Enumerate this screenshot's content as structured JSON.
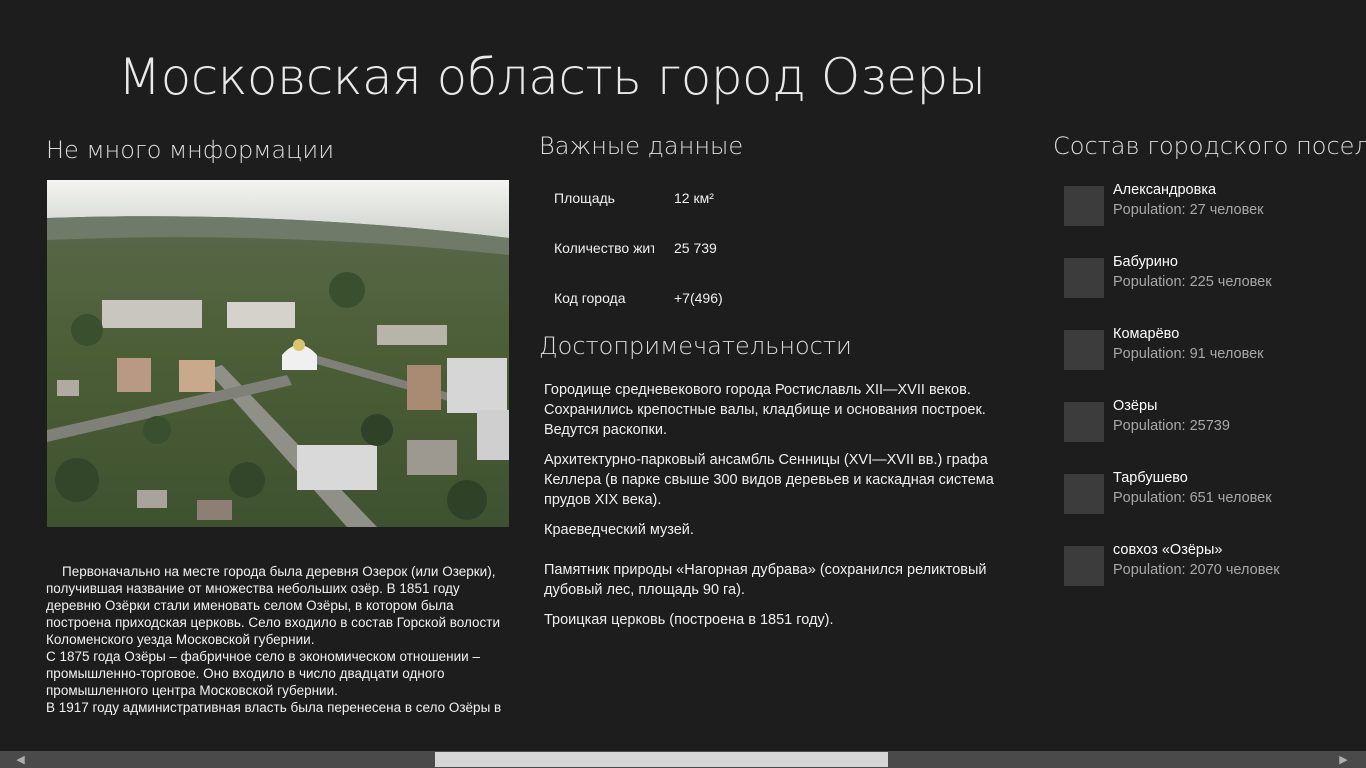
{
  "page": {
    "title": "Московская область город Озеры"
  },
  "info": {
    "heading": "Не много мнформации",
    "photo_alt": "city-aerial-photo",
    "history": [
      "Первоначально на месте города была деревня Озерок (или Озерки), получившая название от множества небольших озёр. В 1851 году деревню Озёрки стали именовать селом Озёры, в котором была построена приходская церковь. Село входило в состав Горской волости Коломенского уезда Московской губернии.",
      "С 1875 года Озёры – фабричное село в экономическом отношении – промышленно-торговое. Оно входило в число двадцати одного промышленного центра Московской губернии.",
      "В 1917 году административная власть была перенесена в село Озёры в"
    ]
  },
  "facts": {
    "heading": "Важные данные",
    "rows": [
      {
        "label": "Площадь",
        "value": "12 км²"
      },
      {
        "label": "Количество жит",
        "value": "25 739"
      },
      {
        "label": "Код города",
        "value": "+7(496)"
      }
    ]
  },
  "sights": {
    "heading": "Достопримечательности",
    "items": [
      "Городище средневекового города Ростиславль XII—XVII веков. Сохранились крепостные валы, кладбище и основания построек. Ведутся раскопки.",
      "Архитектурно-парковый ансамбль Сенницы (XVI—XVII вв.) графа Келлера (в парке свыше 300 видов деревьев и каскадная система прудов XIX века).",
      "Краеведческий музей.",
      "Памятник природы «Нагорная дубрава» (сохранился реликтовый дубовый лес, площадь 90 га).",
      "Троицкая церковь (построена в 1851 году)."
    ]
  },
  "settlements": {
    "heading": "Состав городского поселения",
    "items": [
      {
        "name": "Александровка",
        "population": "Population: 27 человек"
      },
      {
        "name": "Бабурино",
        "population": "Population: 225 человек"
      },
      {
        "name": "Комарёво",
        "population": "Population: 91 человек"
      },
      {
        "name": "Озёры",
        "population": "Population: 25739"
      },
      {
        "name": "Тарбушево",
        "population": "Population: 651 человек"
      },
      {
        "name": "совхоз «Озёры»",
        "population": "Population: 2070 человек"
      }
    ]
  },
  "scrollbar": {
    "left_arrow": "◀",
    "right_arrow": "▶"
  },
  "colors": {
    "background": "#1d1d1d",
    "tile": "#3c3c3c",
    "secondary_text": "#a8a8a8",
    "scrollbar_track": "#4a4a4a",
    "scrollbar_thumb": "#d6d6d6"
  }
}
